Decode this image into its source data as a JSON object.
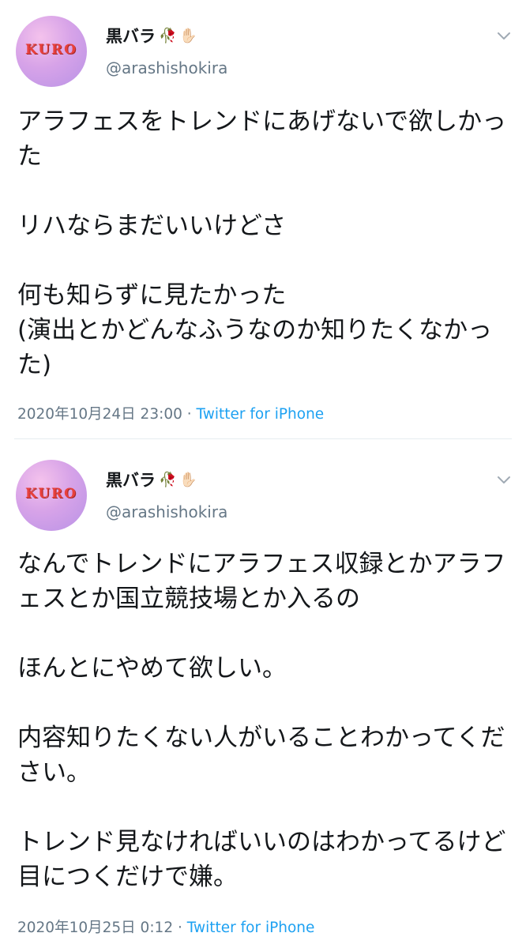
{
  "tweets": [
    {
      "name": "黒バラ",
      "emoji_1": "🥀",
      "emoji_2": "✋🏻",
      "avatar_text": "KURO",
      "handle": "@arashishokira",
      "body": "アラフェスをトレンドにあげないで欲しかった\n\nリハならまだいいけどさ\n\n何も知らずに見たかった\n(演出とかどんなふうなのか知りたくなかった)",
      "timestamp": "2020年10月24日 23:00",
      "separator": "·",
      "source": "Twitter for iPhone"
    },
    {
      "name": "黒バラ",
      "emoji_1": "🥀",
      "emoji_2": "✋🏻",
      "avatar_text": "KURO",
      "handle": "@arashishokira",
      "body": "なんでトレンドにアラフェス収録とかアラフェスとか国立競技場とか入るの\n\nほんとにやめて欲しい。\n\n内容知りたくない人がいることわかってください。\n\nトレンド見なければいいのはわかってるけど目につくだけで嫌。",
      "timestamp": "2020年10月25日 0:12",
      "separator": "·",
      "source": "Twitter for iPhone"
    }
  ],
  "colors": {
    "text": "#14171a",
    "secondary": "#657786",
    "link": "#1da1f2",
    "divider": "#e6ecf0"
  },
  "icons": [
    "rose-emoji-icon",
    "raised-hand-emoji-icon",
    "chevron-down-icon"
  ]
}
